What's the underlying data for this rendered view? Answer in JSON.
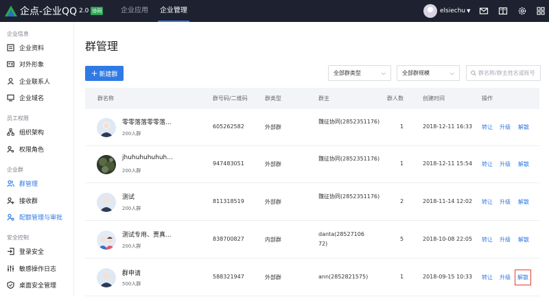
{
  "topbar": {
    "brand": "企点-企业QQ",
    "version": "2.0",
    "badge": "协同",
    "tabs": [
      "企业应用",
      "企业管理"
    ],
    "active_tab": "企业管理",
    "user_name": "elsiechu"
  },
  "sidebar": {
    "groups": [
      {
        "title": "企业信息",
        "items": [
          "企业资料",
          "对外形象",
          "企业联系人",
          "企业域名"
        ]
      },
      {
        "title": "员工权限",
        "items": [
          "组织架构",
          "权限角色"
        ]
      },
      {
        "title": "企业群",
        "items": [
          "群管理",
          "接收群",
          "配额管理与审批"
        ]
      },
      {
        "title": "安全控制",
        "items": [
          "登录安全",
          "敏感操作日志",
          "桌面安全管理"
        ]
      }
    ],
    "active_item": "群管理"
  },
  "main": {
    "title": "群管理",
    "new_button": "新建群",
    "filter_type": "全部群类型",
    "filter_size": "全部群规模",
    "search_placeholder": "群名称/群主姓名或账号"
  },
  "table": {
    "headers": [
      "群名称",
      "群号码/二维码",
      "群类型",
      "群主",
      "群人数",
      "创建时间",
      "操作"
    ],
    "rows": [
      {
        "name": "零零落落零零落...",
        "size": "200人群",
        "number": "605262582",
        "type": "外部群",
        "owner": "魏征协同(2852351176)",
        "members": "1",
        "created": "2018-12-11 16:33",
        "avatar": "default"
      },
      {
        "name": "jhuhuhuhuhuh...",
        "size": "200人群",
        "number": "947483051",
        "type": "外部群",
        "owner": "魏征协同(2852351176)",
        "members": "1",
        "created": "2018-12-11 15:54",
        "avatar": "photo"
      },
      {
        "name": "测试",
        "size": "200人群",
        "number": "811318519",
        "type": "外部群",
        "owner": "魏征协同(2852351176)",
        "members": "2",
        "created": "2018-11-14 12:02",
        "avatar": "default"
      },
      {
        "name": "测试专用、贾真...",
        "size": "200人群",
        "number": "838700827",
        "type": "内部群",
        "owner": "danta(2852710672)",
        "members": "5",
        "created": "2018-10-08 22:05",
        "avatar": "couple"
      },
      {
        "name": "群申请",
        "size": "500人群",
        "number": "588321947",
        "type": "外部群",
        "owner": "ann(2852821575)",
        "members": "1",
        "created": "2018-09-15 10:33",
        "avatar": "default"
      }
    ],
    "actions": [
      "转让",
      "升级",
      "解散"
    ],
    "highlighted_action": {
      "row": 4,
      "action": "解散"
    }
  },
  "colors": {
    "accent": "#2f7ae5",
    "topbar": "#1e2230",
    "highlight": "#e23a2e"
  }
}
